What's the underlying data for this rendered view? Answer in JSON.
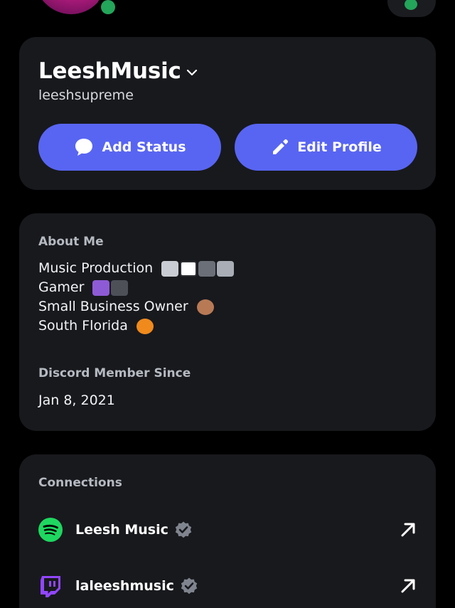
{
  "profile": {
    "display_name": "LeeshMusic",
    "username": "leeshsupreme",
    "add_status_label": "Add Status",
    "edit_profile_label": "Edit Profile"
  },
  "about": {
    "heading": "About Me",
    "lines": [
      "Music Production",
      "Gamer",
      "Small Business Owner",
      "South Florida"
    ],
    "member_since_heading": "Discord Member Since",
    "member_since_date": "Jan 8, 2021"
  },
  "connections": {
    "heading": "Connections",
    "items": [
      {
        "service": "spotify",
        "icon": "spotify-icon",
        "name": "Leesh Music"
      },
      {
        "service": "twitch",
        "icon": "twitch-icon",
        "name": "laleeshmusic"
      }
    ]
  },
  "colors": {
    "background": "#000000",
    "card": "#18191d",
    "accent": "#5865f2",
    "online": "#23a55a",
    "spotify": "#1ed760",
    "twitch": "#9146ff"
  }
}
